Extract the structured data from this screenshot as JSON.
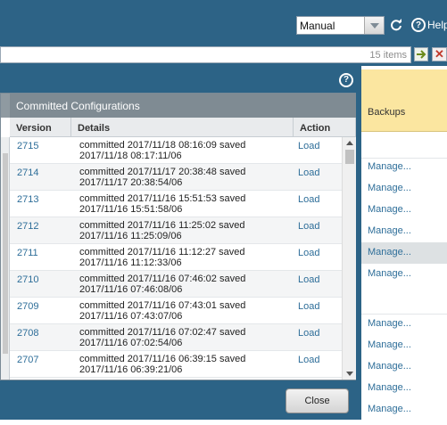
{
  "toolbar": {
    "refresh_mode": "Manual",
    "help_label": "Help"
  },
  "filter": {
    "value": "",
    "count": "15 items"
  },
  "dialog": {
    "title": "Committed Configurations",
    "columns": [
      "Version",
      "Details",
      "Action"
    ],
    "rows": [
      {
        "version": "2715",
        "details1": "committed 2017/11/18 08:16:09 saved",
        "details2": "2017/11/18 08:17:11/06",
        "action": "Load"
      },
      {
        "version": "2714",
        "details1": "committed 2017/11/17 20:38:48 saved",
        "details2": "2017/11/17 20:38:54/06",
        "action": "Load"
      },
      {
        "version": "2713",
        "details1": "committed 2017/11/16 15:51:53 saved",
        "details2": "2017/11/16 15:51:58/06",
        "action": "Load"
      },
      {
        "version": "2712",
        "details1": "committed 2017/11/16 11:25:02 saved",
        "details2": "2017/11/16 11:25:09/06",
        "action": "Load"
      },
      {
        "version": "2711",
        "details1": "committed 2017/11/16 11:12:27 saved",
        "details2": "2017/11/16 11:12:33/06",
        "action": "Load"
      },
      {
        "version": "2710",
        "details1": "committed 2017/11/16 07:46:02 saved",
        "details2": "2017/11/16 07:46:08/06",
        "action": "Load"
      },
      {
        "version": "2709",
        "details1": "committed 2017/11/16 07:43:01 saved",
        "details2": "2017/11/16 07:43:07/06",
        "action": "Load"
      },
      {
        "version": "2708",
        "details1": "committed 2017/11/16 07:02:47 saved",
        "details2": "2017/11/16 07:02:54/06",
        "action": "Load"
      },
      {
        "version": "2707",
        "details1": "committed 2017/11/16 06:39:15 saved",
        "details2": "2017/11/16 06:39:21/06",
        "action": "Load"
      }
    ],
    "close_label": "Close"
  },
  "backups": {
    "header": "Backups",
    "link_label": "Manage..."
  },
  "colors": {
    "toolbar_bg": "#2d6386",
    "panel_title_bg": "#7f8b93",
    "link": "#2e6e99",
    "backups_header_bg": "#fbe6a0"
  }
}
